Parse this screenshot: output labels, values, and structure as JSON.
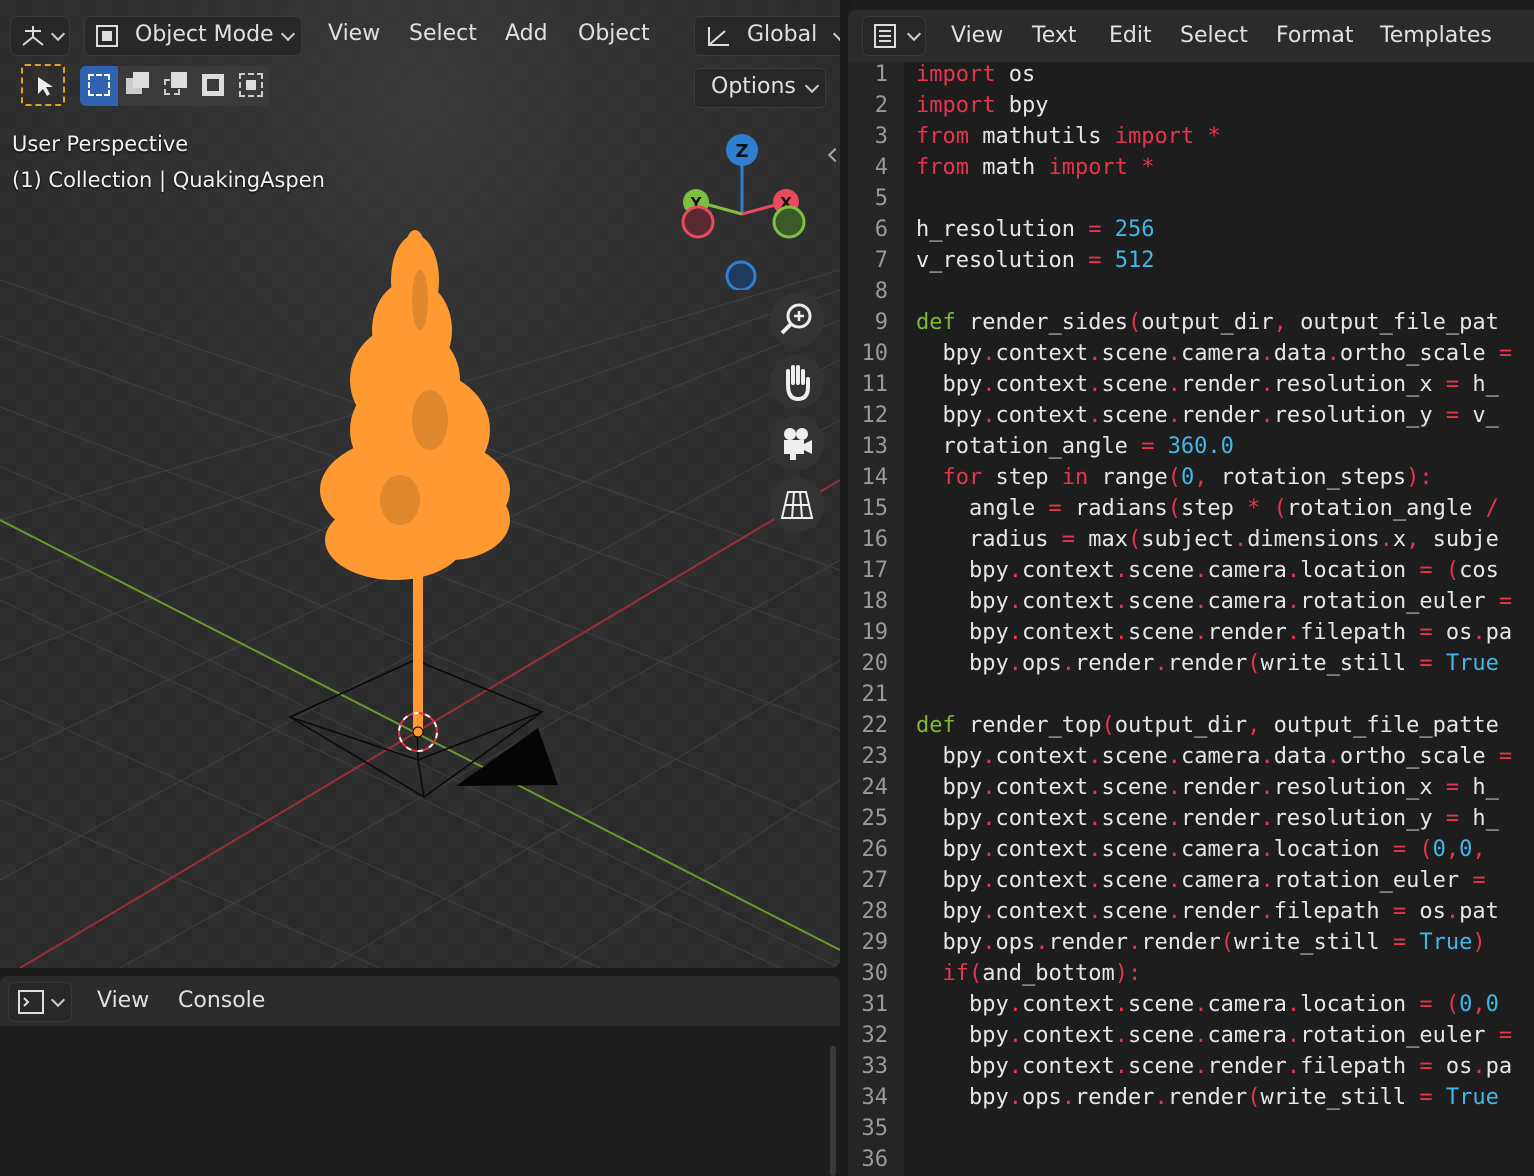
{
  "viewport": {
    "header": {
      "mode_label": "Object Mode",
      "menu": [
        "View",
        "Select",
        "Add",
        "Object"
      ],
      "orientation_label": "Global",
      "options_label": "Options"
    },
    "overlay": {
      "perspective": "User Perspective",
      "collection": "(1) Collection | QuakingAspen"
    },
    "gizmo": {
      "z": "Z",
      "y": "Y",
      "x": "X"
    }
  },
  "console": {
    "menu": [
      "View",
      "Console"
    ]
  },
  "editor": {
    "menu": [
      "View",
      "Text",
      "Edit",
      "Select",
      "Format",
      "Templates"
    ],
    "line_numbers": [
      "1",
      "2",
      "3",
      "4",
      "5",
      "6",
      "7",
      "8",
      "9",
      "10",
      "11",
      "12",
      "13",
      "14",
      "15",
      "16",
      "17",
      "18",
      "19",
      "20",
      "21",
      "22",
      "23",
      "24",
      "25",
      "26",
      "27",
      "28",
      "29",
      "30",
      "31",
      "32",
      "33",
      "34",
      "35",
      "36"
    ],
    "lines": [
      "import os",
      "import bpy",
      "from mathutils import *",
      "from math import *",
      "",
      "h_resolution = 256",
      "v_resolution = 512",
      "",
      "def render_sides(output_dir, output_file_pat",
      "  bpy.context.scene.camera.data.ortho_scale =",
      "  bpy.context.scene.render.resolution_x = h_",
      "  bpy.context.scene.render.resolution_y = v_",
      "  rotation_angle = 360.0",
      "  for step in range(0, rotation_steps):",
      "    angle = radians(step * (rotation_angle /",
      "    radius = max(subject.dimensions.x, subje",
      "    bpy.context.scene.camera.location = (cos",
      "    bpy.context.scene.camera.rotation_euler =",
      "    bpy.context.scene.render.filepath = os.pa",
      "    bpy.ops.render.render(write_still = True",
      "",
      "def render_top(output_dir, output_file_patte",
      "  bpy.context.scene.camera.data.ortho_scale =",
      "  bpy.context.scene.render.resolution_x = h_",
      "  bpy.context.scene.render.resolution_y = h_",
      "  bpy.context.scene.camera.location = (0,0,",
      "  bpy.context.scene.camera.rotation_euler =",
      "  bpy.context.scene.render.filepath = os.pat",
      "  bpy.ops.render.render(write_still = True)",
      "  if(and_bottom):",
      "    bpy.context.scene.camera.location = (0,0",
      "    bpy.context.scene.camera.rotation_euler =",
      "    bpy.context.scene.render.filepath = os.pa",
      "    bpy.ops.render.render(write_still = True",
      "",
      ""
    ]
  },
  "colors": {
    "accent_orange": "#ff9a33",
    "keyword": "#e8344d",
    "def_keyword": "#7fb836",
    "number": "#44b7e8",
    "axis_x": "#e84a5f",
    "axis_y": "#7fbf3f",
    "axis_z": "#2f7fd1"
  }
}
